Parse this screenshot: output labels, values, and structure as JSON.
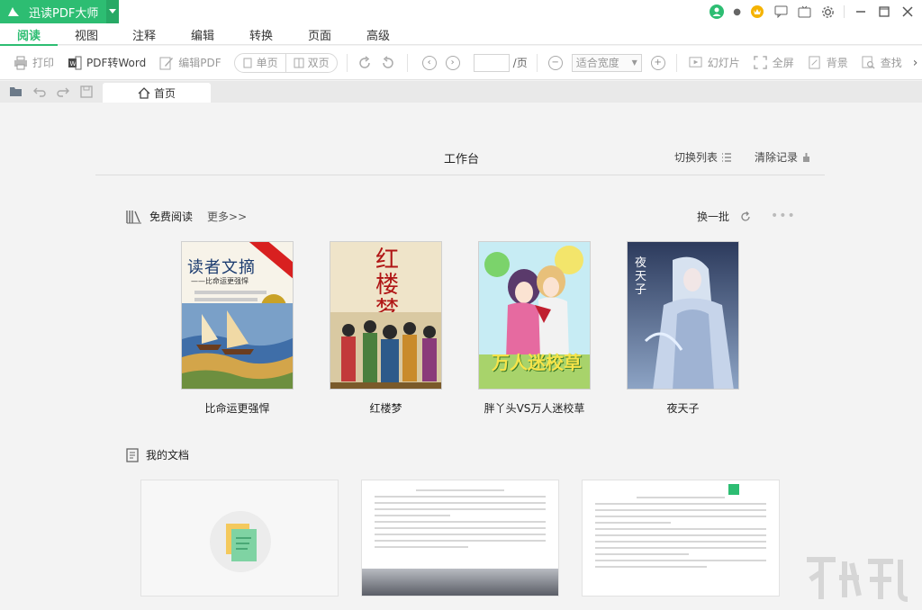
{
  "app": {
    "name": "迅读PDF大师",
    "brand_color": "#2dbd72"
  },
  "menu": {
    "tabs": [
      "阅读",
      "视图",
      "注释",
      "编辑",
      "转换",
      "页面",
      "高级"
    ],
    "active": "阅读"
  },
  "toolbar": {
    "print": "打印",
    "pdf_to_word": "PDF转Word",
    "edit_pdf": "编辑PDF",
    "single_page": "单页",
    "double_page": "双页",
    "page_suffix": "/页",
    "zoom": "适合宽度",
    "slideshow": "幻灯片",
    "fullscreen": "全屏",
    "background": "背景",
    "find": "查找"
  },
  "tabs": {
    "home": "首页"
  },
  "workspace": {
    "title": "工作台",
    "switch_list": "切换列表",
    "clear_history": "清除记录"
  },
  "free_reading": {
    "heading": "免费阅读",
    "more": "更多>>",
    "refresh": "换一批",
    "books": [
      {
        "title": "比命运更强悍",
        "cover_text": "读者文摘",
        "cover_sub": "——比命运更强悍",
        "icon": "ships-painting"
      },
      {
        "title": "红楼梦",
        "cover_text": "红楼梦",
        "icon": "classical-figures"
      },
      {
        "title": "胖丫头VS万人迷校草",
        "cover_text": "万人迷校草",
        "icon": "anime-couple"
      },
      {
        "title": "夜天子",
        "cover_text": "夜天子",
        "icon": "fantasy-elf"
      }
    ]
  },
  "my_docs": {
    "heading": "我的文档"
  },
  "icons": {
    "print": "printer-icon",
    "word": "word-icon",
    "edit": "edit-icon"
  }
}
